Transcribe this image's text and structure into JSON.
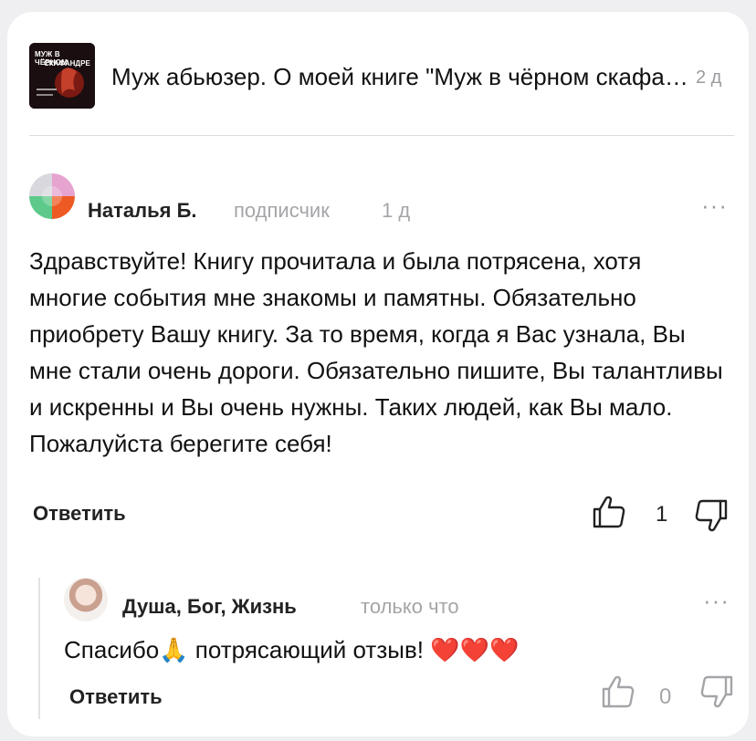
{
  "post": {
    "thumbnail_text_1": "МУЖ В ЧЁРНОМ",
    "thumbnail_text_2": "СКАФАНДРЕ",
    "title": "Муж абьюзер. О моей книге \"Муж в чёрном скафандре\"",
    "time": "2 д"
  },
  "comment": {
    "author": "Наталья Б.",
    "badge": "подписчик",
    "time": "1 д",
    "text": "Здравствуйте! Книгу прочитала и была потрясена, хотя многие события мне знакомы и памятны. Обязательно приобрету Вашу книгу. За то время, когда я Вас узнала, Вы мне стали очень дороги. Обязательно пишите, Вы талантливы и искренны и Вы очень нужны. Таких людей, как Вы мало. Пожалуйста берегите себя!",
    "reply_label": "Ответить",
    "likes": "1",
    "icons": [
      "more-icon",
      "thumbs-up-icon",
      "thumbs-down-icon"
    ]
  },
  "reply": {
    "author": "Душа, Бог, Жизнь",
    "time": "только что",
    "text_start": "Спасибо",
    "text_end": " потрясающий отзыв! ",
    "hearts": "❤️❤️❤️",
    "pray_emoji": "🙏",
    "reply_label": "Ответить",
    "likes": "0"
  },
  "colors": {
    "background": "#efeff1",
    "card": "#ffffff",
    "muted_text": "#a5a5a9",
    "heart": "#e02020"
  }
}
